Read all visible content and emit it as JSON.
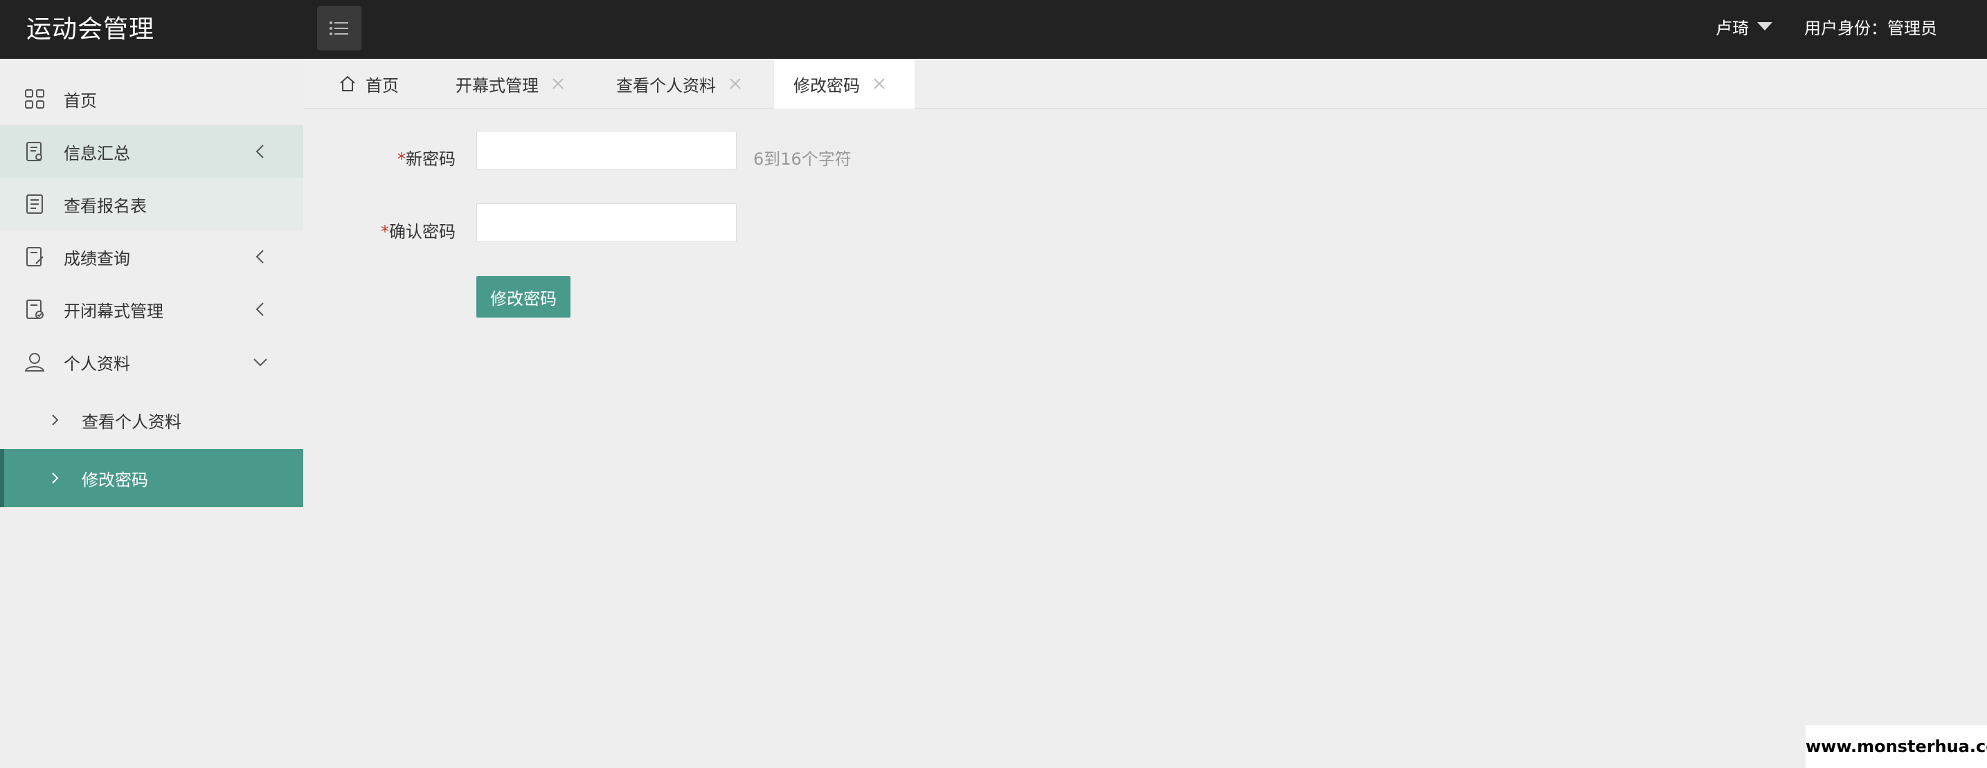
{
  "header": {
    "app_title": "运动会管理",
    "menu_toggle_icon": "list-icon",
    "user_name": "卢琦",
    "role_text": "用户身份：管理员"
  },
  "sidebar": {
    "items": [
      {
        "label": "首页",
        "icon": "grid-icon"
      },
      {
        "label": "信息汇总",
        "icon": "document-icon",
        "arrow": "chevron-left-icon"
      },
      {
        "label": "查看报名表",
        "icon": "form-icon"
      },
      {
        "label": "成绩查询",
        "icon": "edit-document-icon",
        "arrow": "chevron-left-icon"
      },
      {
        "label": "开闭幕式管理",
        "icon": "check-document-icon",
        "arrow": "chevron-left-icon"
      },
      {
        "label": "个人资料",
        "icon": "user-icon",
        "arrow": "chevron-down-icon"
      }
    ],
    "sub_items": [
      {
        "label": "查看个人资料"
      },
      {
        "label": "修改密码"
      }
    ]
  },
  "tabs": [
    {
      "label": "首页",
      "icon": "home-icon"
    },
    {
      "label": "开幕式管理"
    },
    {
      "label": "查看个人资料"
    },
    {
      "label": "修改密码"
    }
  ],
  "form": {
    "required_mark": "*",
    "new_password_label": "新密码",
    "new_password_hint": "6到16个字符",
    "confirm_password_label": "确认密码",
    "submit_label": "修改密码"
  },
  "watermark": "www.monsterhua.com",
  "colors": {
    "header_bg": "#222222",
    "accent": "#4a9a8c",
    "page_bg": "#eeeeee"
  }
}
